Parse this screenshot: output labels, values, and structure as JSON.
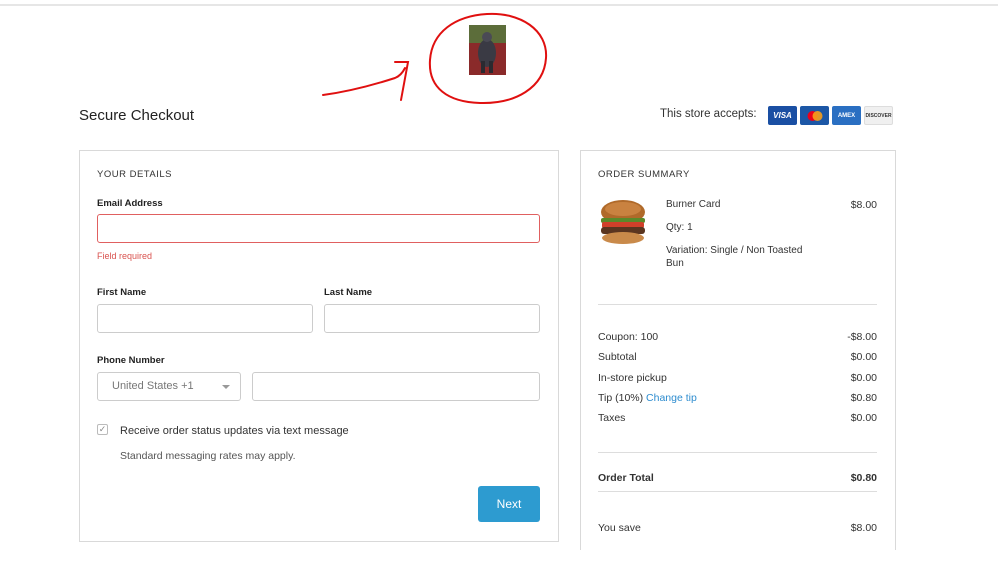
{
  "header": {
    "title": "Secure Checkout",
    "accepts_label": "This store accepts:",
    "cards": [
      {
        "name": "visa",
        "label": "VISA",
        "color": "#1a4fa3"
      },
      {
        "name": "mastercard",
        "label": "",
        "color": "#1c57a6"
      },
      {
        "name": "amex",
        "label": "AMEX",
        "color": "#2a6fc2"
      },
      {
        "name": "discover",
        "label": "DISCOVER",
        "color": "#f0f0f0"
      }
    ]
  },
  "annotation": {
    "color": "#e01010"
  },
  "details": {
    "heading": "YOUR DETAILS",
    "email_label": "Email Address",
    "email_value": "",
    "email_error": "Field required",
    "first_name_label": "First Name",
    "last_name_label": "Last Name",
    "phone_label": "Phone Number",
    "country_select": "United States +1",
    "sms_checkbox_label": "Receive order status updates via text message",
    "sms_note": "Standard messaging rates may apply.",
    "next_button": "Next",
    "accent_color": "#2d9bd0"
  },
  "summary": {
    "heading": "ORDER SUMMARY",
    "item": {
      "name": "Burner Card",
      "qty": "Qty: 1",
      "variation": "Variation: Single / Non Toasted",
      "variation_cont": "Bun",
      "price": "$8.00"
    },
    "rows": [
      {
        "label": "Coupon: 100",
        "value": "-$8.00"
      },
      {
        "label": "Subtotal",
        "value": "$0.00"
      },
      {
        "label": "In-store pickup",
        "value": "$0.00"
      },
      {
        "label": "Tip (10%)",
        "link": "Change tip",
        "value": "$0.80"
      },
      {
        "label": "Taxes",
        "value": "$0.00"
      }
    ],
    "total_label": "Order Total",
    "total_value": "$0.80",
    "save_label": "You save",
    "save_value": "$8.00"
  }
}
